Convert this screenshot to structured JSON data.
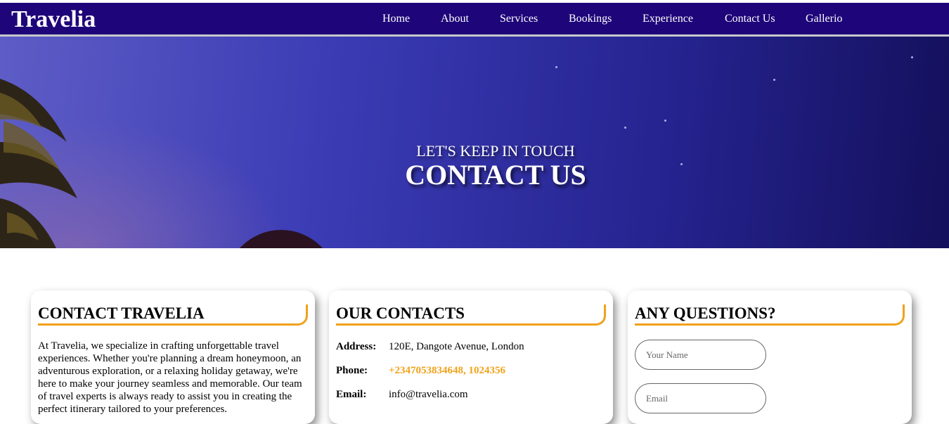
{
  "nav": {
    "brand": "Travelia",
    "items": [
      {
        "label": "Home"
      },
      {
        "label": "About"
      },
      {
        "label": "Services"
      },
      {
        "label": "Bookings"
      },
      {
        "label": "Experience"
      },
      {
        "label": "Contact Us"
      },
      {
        "label": "Gallerio"
      }
    ]
  },
  "hero": {
    "subtitle": "LET'S KEEP IN TOUCH",
    "title": "CONTACT US"
  },
  "about_card": {
    "title": "CONTACT TRAVELIA",
    "text": "At Travelia, we specialize in crafting unforgettable travel experiences. Whether you're planning a dream honeymoon, an adventurous exploration, or a relaxing holiday getaway, we're here to make your journey seamless and memorable. Our team of travel experts is always ready to assist you in creating the perfect itinerary tailored to your preferences."
  },
  "contacts_card": {
    "title": "OUR CONTACTS",
    "address_label": "Address:",
    "address": "120E, Dangote Avenue, London",
    "phone_label": "Phone:",
    "phone": "+2347053834648, 1024356",
    "email_label": "Email:",
    "email": "info@travelia.com"
  },
  "questions_card": {
    "title": "ANY QUESTIONS?",
    "name_placeholder": "Your Name",
    "email_placeholder": "Email"
  },
  "colors": {
    "nav_bg": "#1e0579",
    "accent": "#f0a21b"
  }
}
